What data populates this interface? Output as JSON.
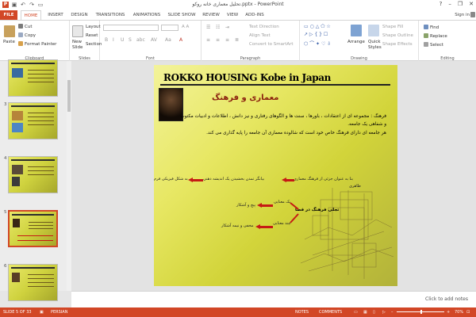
{
  "app": {
    "title": "تحلیل معماری خانه روکو.pptx - PowerPoint"
  },
  "window": {
    "minimize": "–",
    "restore": "❐",
    "close": "✕",
    "help": "?"
  },
  "tabs": [
    "FILE",
    "HOME",
    "INSERT",
    "DESIGN",
    "TRANSITIONS",
    "ANIMATIONS",
    "SLIDE SHOW",
    "REVIEW",
    "VIEW",
    "ADD-INS"
  ],
  "signin": "Sign in",
  "ribbon": {
    "clipboard": {
      "label": "Clipboard",
      "paste": "Paste",
      "cut": "Cut",
      "copy": "Copy",
      "format_painter": "Format Painter"
    },
    "slides": {
      "label": "Slides",
      "new_slide": "New",
      "new_slide2": "Slide",
      "layout": "Layout",
      "reset": "Reset",
      "section": "Section"
    },
    "font": {
      "label": "Font"
    },
    "paragraph": {
      "label": "Paragraph",
      "text_direction": "Text Direction",
      "align_text": "Align Text",
      "convert": "Convert to SmartArt"
    },
    "drawing": {
      "label": "Drawing",
      "arrange": "Arrange",
      "quick_styles": "Quick",
      "quick_styles2": "Styles",
      "shape_fill": "Shape Fill",
      "shape_outline": "Shape Outline",
      "shape_effects": "Shape Effects"
    },
    "editing": {
      "label": "Editing",
      "find": "Find",
      "replace": "Replace",
      "select": "Select"
    }
  },
  "thumbnails": [
    {
      "num": "",
      "selected": false
    },
    {
      "num": "3",
      "selected": false
    },
    {
      "num": "4",
      "selected": false
    },
    {
      "num": "5",
      "selected": true
    },
    {
      "num": "6",
      "selected": false
    }
  ],
  "slide": {
    "title": "ROKKO HOUSING   Kobe in Japan",
    "heading": "معماری و فرهنگ",
    "body": [
      "فرهنگ : مجموعه ای از اعتقادات ، باورها ، سنت ها و الگوهای رفتاری و نیز دانش ، اطلاعات و ادبیات مکتوب و شفاهی یک جامعه.",
      "هر جامعه ای دارای فرهنگ خاص خود است که شالوده معماری آن جامعه را پایه گذاری می کند."
    ],
    "notes": {
      "left1": "بنا به عنوان جزئی از فرهنگ معماری",
      "left1b": "ظاهری",
      "mid1": "بیانگر تمدن بخشیدن یک اندیشه ذهنی",
      "right1": "به شکل فیزیکی فرم",
      "center": "تجلی فرهنگ در فضا",
      "m2": "یک معنایی",
      "l2": "پیچ و آشکار",
      "m3": "چند معنایی",
      "l3": "مخفی و نیمه آشکار"
    }
  },
  "notes_placeholder": "Click to add notes",
  "status": {
    "slide": "SLIDE 5 OF 33",
    "language": "PERSIAN",
    "notes": "NOTES",
    "comments": "COMMENTS",
    "zoom": "70%"
  }
}
